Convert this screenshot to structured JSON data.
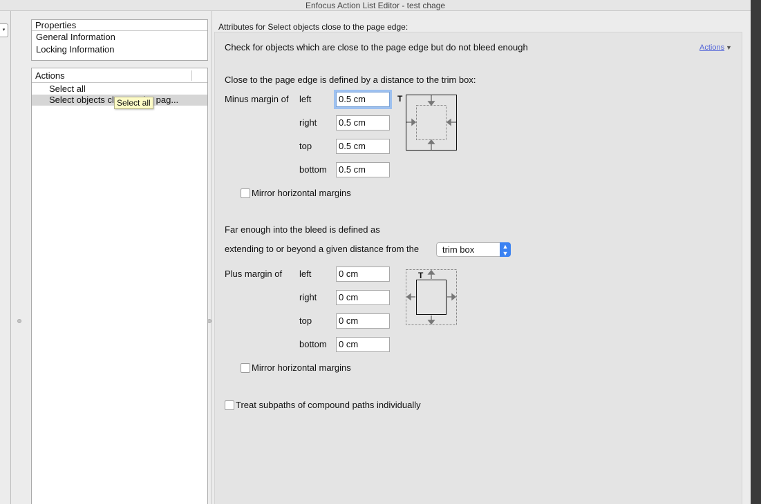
{
  "window": {
    "title": "Enfocus Action List Editor - test chage"
  },
  "left_strip": {
    "popup_caret": "▾"
  },
  "properties": {
    "header": "Properties",
    "items": [
      {
        "label": "General Information"
      },
      {
        "label": "Locking Information"
      }
    ]
  },
  "actions_panel": {
    "header": "Actions",
    "items": [
      {
        "label": "Select all",
        "selected": false
      },
      {
        "label": "Select objects close to the pag...",
        "selected": true
      }
    ]
  },
  "tooltip": "Select all",
  "attributes": {
    "title": "Attributes for Select objects close to the page edge:",
    "description": "Check for objects which are close to the page edge but do not bleed enough",
    "actions_link": "Actions",
    "actions_caret": "▼",
    "close_section": {
      "intro": "Close to the page edge is defined by a distance to the trim box:",
      "group_label": "Minus margin of",
      "diagram_label": "T",
      "margins": [
        {
          "label": "left",
          "value": "0.5 cm",
          "focused": true
        },
        {
          "label": "right",
          "value": "0.5 cm"
        },
        {
          "label": "top",
          "value": "0.5 cm"
        },
        {
          "label": "bottom",
          "value": "0.5 cm"
        }
      ],
      "mirror_label": "Mirror horizontal margins",
      "mirror_checked": false
    },
    "bleed_section": {
      "intro": "Far enough into the bleed is defined as",
      "extend_label": "extending to or beyond a given distance from the",
      "box_select_value": "trim box",
      "group_label": "Plus margin of",
      "diagram_label": "T",
      "margins": [
        {
          "label": "left",
          "value": "0 cm"
        },
        {
          "label": "right",
          "value": "0 cm"
        },
        {
          "label": "top",
          "value": "0 cm"
        },
        {
          "label": "bottom",
          "value": "0 cm"
        }
      ],
      "mirror_label": "Mirror horizontal margins",
      "mirror_checked": false
    },
    "subpaths_label": "Treat subpaths of compound paths individually",
    "subpaths_checked": false
  },
  "colors": {
    "accent": "#3b82f2",
    "focus_ring": "#9dc0ef",
    "link": "#5063d8",
    "tooltip_bg": "#fdfbc6"
  },
  "icons": {
    "select_arrow": "up-down-chevron-icon"
  }
}
